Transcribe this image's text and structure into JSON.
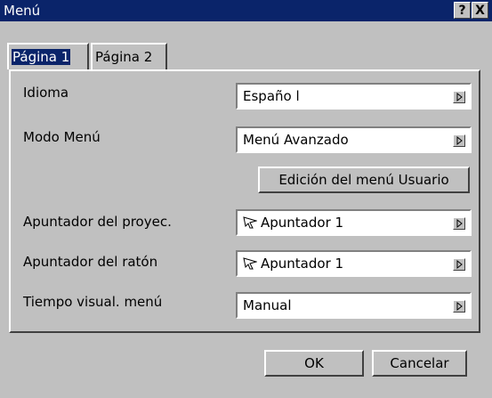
{
  "window": {
    "title": "Menú",
    "help_label": "?",
    "close_label": "X"
  },
  "tabs": [
    {
      "label": "Página 1"
    },
    {
      "label": "Página 2"
    }
  ],
  "settings": {
    "idioma": {
      "label": "Idioma",
      "value": "Españo l"
    },
    "modo_menu": {
      "label": "Modo Menú",
      "value": "Menú Avanzado"
    },
    "edit_user_menu_button": "Edición del menú Usuario",
    "apuntador_proyec": {
      "label": "Apuntador del proyec.",
      "value": "Apuntador 1",
      "icon": "pointer-hand-icon"
    },
    "apuntador_raton": {
      "label": "Apuntador del ratón",
      "value": "Apuntador 1",
      "icon": "pointer-hand-icon"
    },
    "tiempo_visual": {
      "label": "Tiempo visual. menú",
      "value": "Manual"
    }
  },
  "footer": {
    "ok_label": "OK",
    "cancel_label": "Cancelar"
  }
}
